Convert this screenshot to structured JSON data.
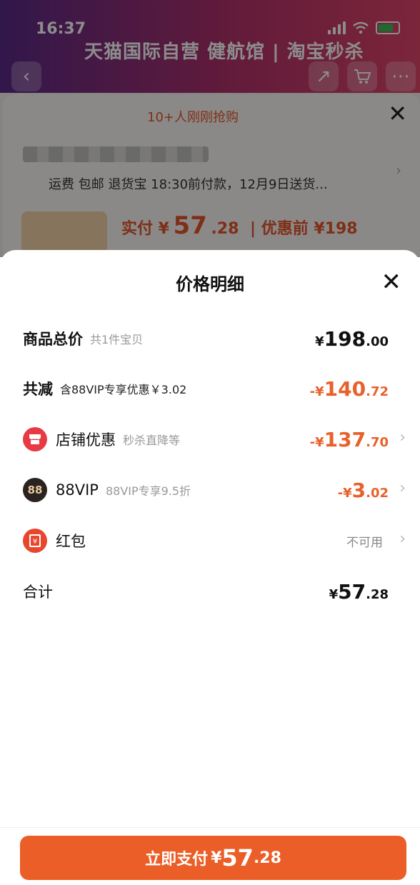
{
  "status_bar": {
    "time": "16:37"
  },
  "background": {
    "banner_text": "天猫国际自营 健航馆 | 淘宝秒杀",
    "grab_text": "10+人刚刚抢购",
    "shipping_text": "运费 包邮 退货宝 18:30前付款，12月9日送货...",
    "pay_label": "实付 ¥",
    "pay_int": "57",
    "pay_dec": ".28",
    "pay_before": "| 优惠前 ¥198"
  },
  "sheet": {
    "title": "价格明细",
    "rows": [
      {
        "label": "商品总价",
        "sub": "共1件宝贝",
        "yen": "¥",
        "int": "198",
        "dec": ".00"
      },
      {
        "label": "共减",
        "sub": "含88VIP专享优惠￥3.02",
        "yen": "-¥",
        "int": "140",
        "dec": ".72"
      },
      {
        "label": "店铺优惠",
        "sub": "秒杀直降等",
        "yen": "-¥",
        "int": "137",
        "dec": ".70"
      },
      {
        "label": "88VIP",
        "icon_text": "88",
        "sub": "88VIP专享9.5折",
        "yen": "-¥",
        "int": "3",
        "dec": ".02"
      },
      {
        "label": "红包",
        "status": "不可用"
      },
      {
        "label": "合计",
        "yen": "¥",
        "int": "57",
        "dec": ".28"
      }
    ]
  },
  "footer": {
    "button_label": "立即支付",
    "yen": "¥",
    "int": "57",
    "dec": ".28"
  },
  "colors": {
    "accent": "#ec5e27",
    "discount": "#e8612c"
  }
}
